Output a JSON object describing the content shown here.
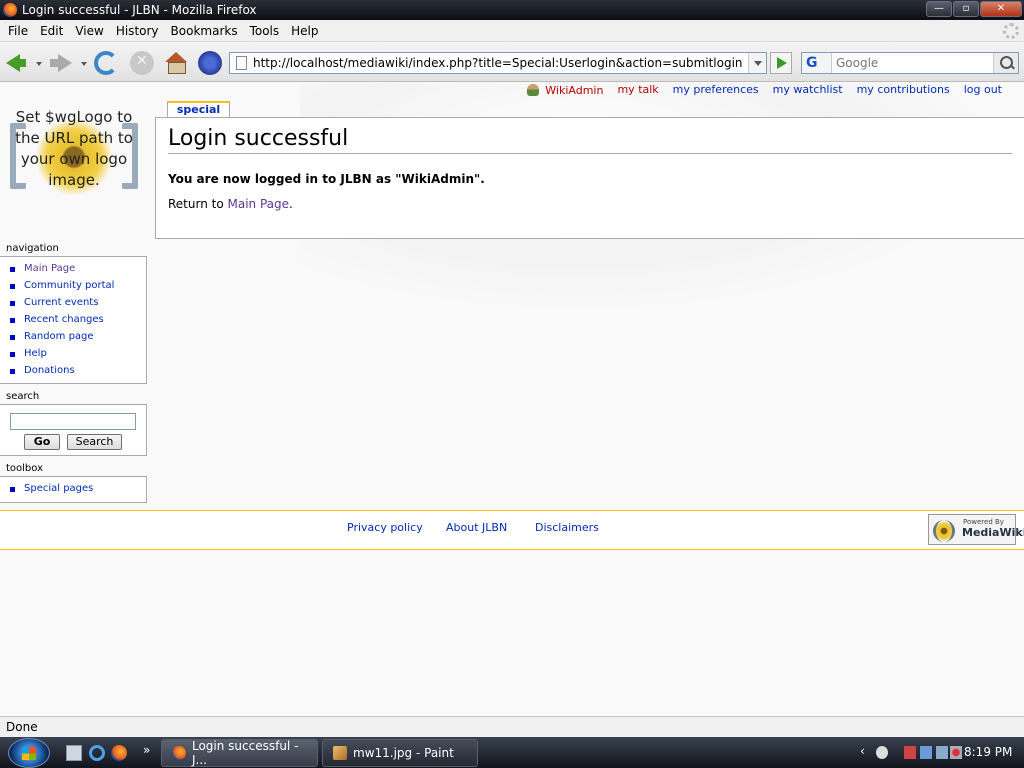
{
  "window": {
    "title": "Login successful - JLBN - Mozilla Firefox",
    "buttons": [
      "minimize",
      "maximize",
      "close"
    ]
  },
  "menubar": {
    "items": [
      "File",
      "Edit",
      "View",
      "History",
      "Bookmarks",
      "Tools",
      "Help"
    ]
  },
  "navbar": {
    "url": "http://localhost/mediawiki/index.php?title=Special:Userlogin&action=submitlogin&type=login",
    "search_placeholder": "Google",
    "search_engine": "G"
  },
  "personal": {
    "items": [
      "WikiAdmin",
      "my talk",
      "my preferences",
      "my watchlist",
      "my contributions",
      "log out"
    ]
  },
  "logo": {
    "text": "Set $wgLogo to the URL path to your own logo image."
  },
  "tab": {
    "label": "special"
  },
  "main": {
    "heading": "Login successful",
    "message": "You are now logged in to JLBN as \"WikiAdmin\".",
    "return_prefix": "Return to",
    "return_link": "Main Page",
    "return_suffix": "."
  },
  "sidebar": {
    "navigation": {
      "heading": "navigation",
      "items": [
        "Main Page",
        "Community portal",
        "Current events",
        "Recent changes",
        "Random page",
        "Help",
        "Donations"
      ]
    },
    "search": {
      "heading": "search",
      "go_label": "Go",
      "search_label": "Search",
      "value": ""
    },
    "toolbox": {
      "heading": "toolbox",
      "items": [
        "Special pages"
      ]
    }
  },
  "footer": {
    "links": [
      "Privacy policy",
      "About JLBN",
      "Disclaimers"
    ],
    "powered_small": "Powered By",
    "powered_big": "MediaWiki"
  },
  "status": {
    "text": "Done"
  },
  "taskbar": {
    "tasks": [
      "Login successful - J...",
      "mw11.jpg - Paint"
    ],
    "clock": "8:19 PM",
    "more": "»"
  },
  "colors": {
    "link": "#002bb8",
    "visited": "#5a3696",
    "new_link": "#ba0000",
    "tab_accent": "#fabd23"
  }
}
